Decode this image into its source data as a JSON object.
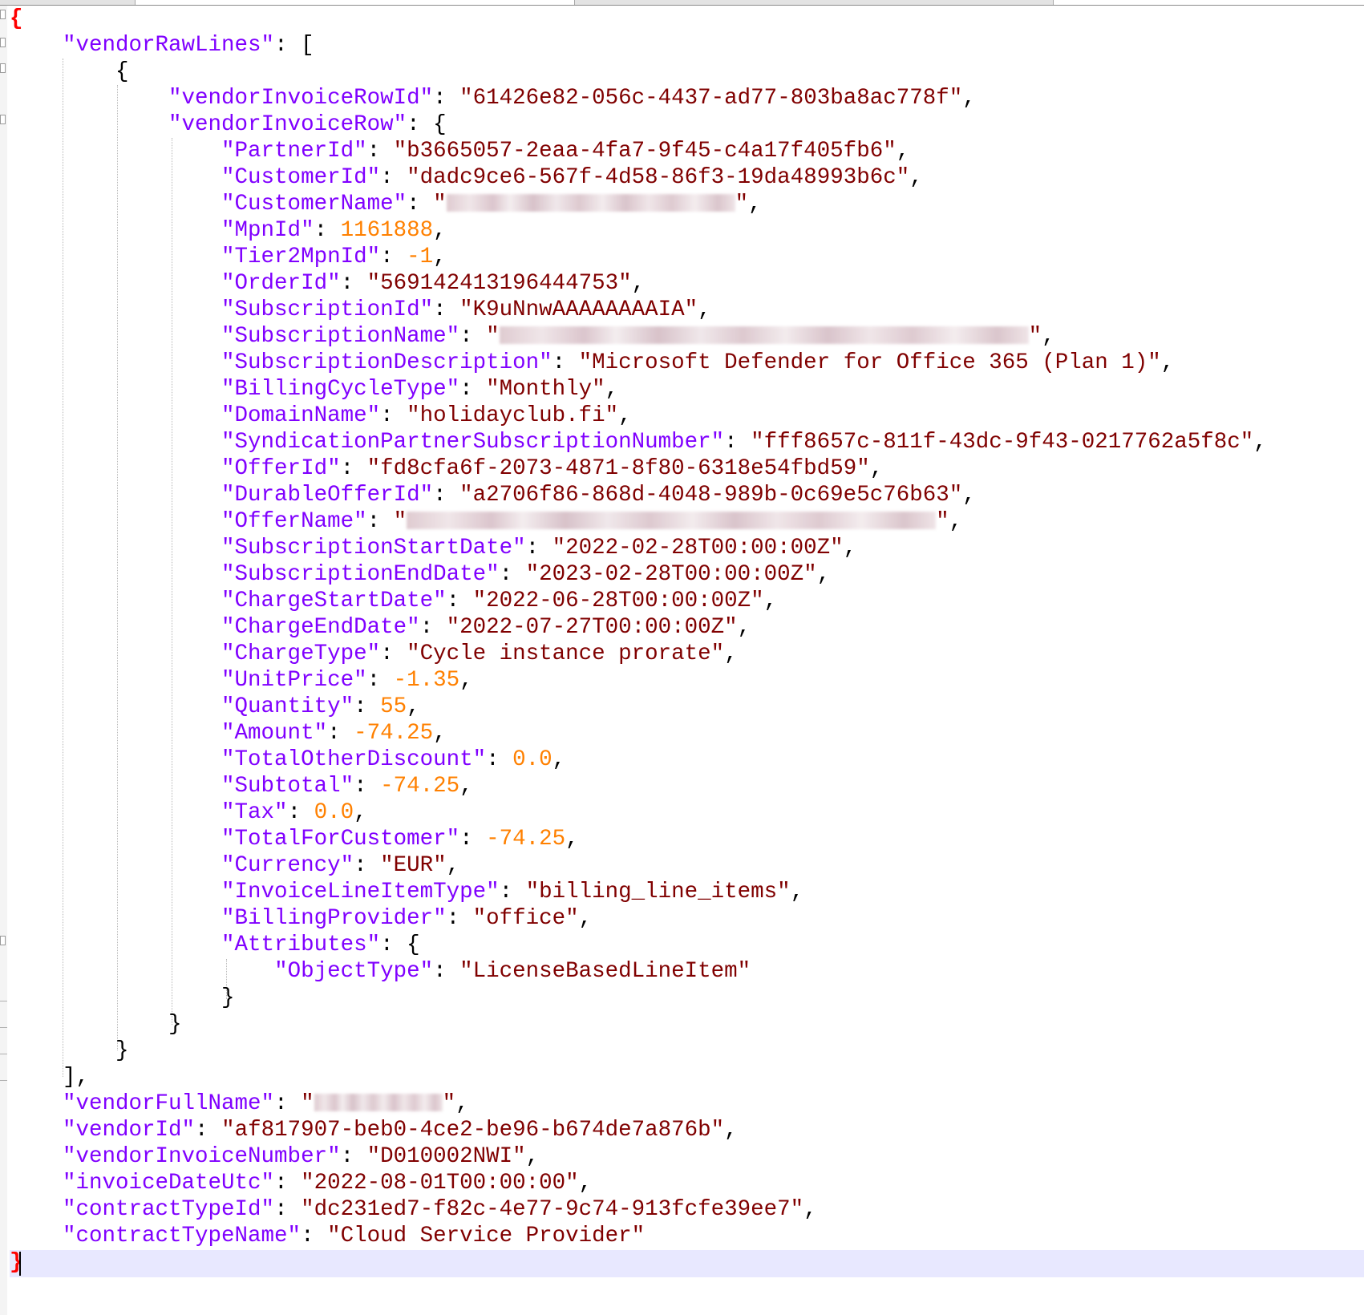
{
  "editor": {
    "open_brace": "{",
    "close_brace": "}",
    "vendorRawLines_key": "\"vendorRawLines\"",
    "vendorInvoiceRowId_key": "\"vendorInvoiceRowId\"",
    "vendorInvoiceRowId_val": "\"61426e82-056c-4437-ad77-803ba8ac778f\"",
    "vendorInvoiceRow_key": "\"vendorInvoiceRow\"",
    "rows": [
      {
        "key": "\"PartnerId\"",
        "val": "\"b3665057-2eaa-4fa7-9f45-c4a17f405fb6\"",
        "type": "s"
      },
      {
        "key": "\"CustomerId\"",
        "val": "\"dadc9ce6-567f-4d58-86f3-19da48993b6c\"",
        "type": "s"
      },
      {
        "key": "\"CustomerName\"",
        "val": "",
        "type": "blur"
      },
      {
        "key": "\"MpnId\"",
        "val": "1161888",
        "type": "n"
      },
      {
        "key": "\"Tier2MpnId\"",
        "val": "-1",
        "type": "n"
      },
      {
        "key": "\"OrderId\"",
        "val": "\"569142413196444753\"",
        "type": "s"
      },
      {
        "key": "\"SubscriptionId\"",
        "val": "\"K9uNnwAAAAAAAAIA\"",
        "type": "s"
      },
      {
        "key": "\"SubscriptionName\"",
        "val": "",
        "type": "blur"
      },
      {
        "key": "\"SubscriptionDescription\"",
        "val": "\"Microsoft Defender for Office 365 (Plan 1)\"",
        "type": "s"
      },
      {
        "key": "\"BillingCycleType\"",
        "val": "\"Monthly\"",
        "type": "s"
      },
      {
        "key": "\"DomainName\"",
        "val": "\"holidayclub.fi\"",
        "type": "s"
      },
      {
        "key": "\"SyndicationPartnerSubscriptionNumber\"",
        "val": "\"fff8657c-811f-43dc-9f43-0217762a5f8c\"",
        "type": "s"
      },
      {
        "key": "\"OfferId\"",
        "val": "\"fd8cfa6f-2073-4871-8f80-6318e54fbd59\"",
        "type": "s"
      },
      {
        "key": "\"DurableOfferId\"",
        "val": "\"a2706f86-868d-4048-989b-0c69e5c76b63\"",
        "type": "s"
      },
      {
        "key": "\"OfferName\"",
        "val": "",
        "type": "blur"
      },
      {
        "key": "\"SubscriptionStartDate\"",
        "val": "\"2022-02-28T00:00:00Z\"",
        "type": "s"
      },
      {
        "key": "\"SubscriptionEndDate\"",
        "val": "\"2023-02-28T00:00:00Z\"",
        "type": "s"
      },
      {
        "key": "\"ChargeStartDate\"",
        "val": "\"2022-06-28T00:00:00Z\"",
        "type": "s"
      },
      {
        "key": "\"ChargeEndDate\"",
        "val": "\"2022-07-27T00:00:00Z\"",
        "type": "s"
      },
      {
        "key": "\"ChargeType\"",
        "val": "\"Cycle instance prorate\"",
        "type": "s"
      },
      {
        "key": "\"UnitPrice\"",
        "val": "-1.35",
        "type": "n"
      },
      {
        "key": "\"Quantity\"",
        "val": "55",
        "type": "n"
      },
      {
        "key": "\"Amount\"",
        "val": "-74.25",
        "type": "n"
      },
      {
        "key": "\"TotalOtherDiscount\"",
        "val": "0.0",
        "type": "n"
      },
      {
        "key": "\"Subtotal\"",
        "val": "-74.25",
        "type": "n"
      },
      {
        "key": "\"Tax\"",
        "val": "0.0",
        "type": "n"
      },
      {
        "key": "\"TotalForCustomer\"",
        "val": "-74.25",
        "type": "n"
      },
      {
        "key": "\"Currency\"",
        "val": "\"EUR\"",
        "type": "s"
      },
      {
        "key": "\"InvoiceLineItemType\"",
        "val": "\"billing_line_items\"",
        "type": "s"
      },
      {
        "key": "\"BillingProvider\"",
        "val": "\"office\"",
        "type": "s"
      }
    ],
    "attributes_key": "\"Attributes\"",
    "objectType_key": "\"ObjectType\"",
    "objectType_val": "\"LicenseBasedLineItem\"",
    "tail": [
      {
        "key": "\"vendorFullName\"",
        "val": "",
        "type": "blur"
      },
      {
        "key": "\"vendorId\"",
        "val": "\"af817907-beb0-4ce2-be96-b674de7a876b\"",
        "type": "s"
      },
      {
        "key": "\"vendorInvoiceNumber\"",
        "val": "\"D010002NWI\"",
        "type": "s"
      },
      {
        "key": "\"invoiceDateUtc\"",
        "val": "\"2022-08-01T00:00:00\"",
        "type": "s"
      },
      {
        "key": "\"contractTypeId\"",
        "val": "\"dc231ed7-f82c-4e77-9c74-913fcfe39ee7\"",
        "type": "s"
      },
      {
        "key": "\"contractTypeName\"",
        "val": "\"Cloud Service Provider\"",
        "type": "s"
      }
    ]
  },
  "colors": {
    "key": "#8000ff",
    "string": "#800000",
    "number": "#ff8000",
    "brace": "#ff0000",
    "current_line": "#e8e8ff"
  }
}
